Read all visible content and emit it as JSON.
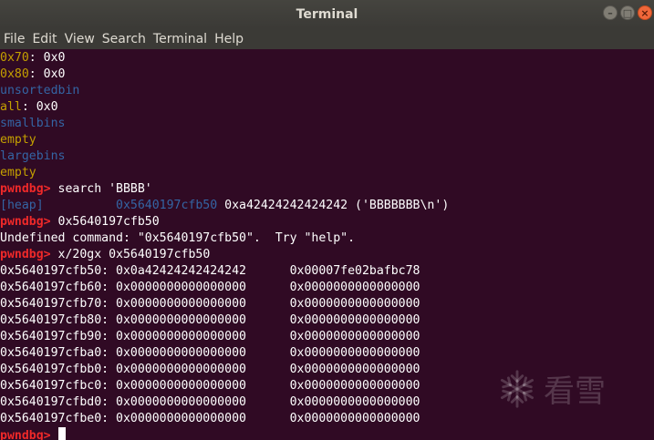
{
  "window": {
    "title": "Terminal"
  },
  "menu": [
    "File",
    "Edit",
    "View",
    "Search",
    "Terminal",
    "Help"
  ],
  "terminal": {
    "lines": [
      [
        {
          "t": "0x70",
          "c": "yellow"
        },
        {
          "t": ": 0x0",
          "c": ""
        }
      ],
      [
        {
          "t": "0x80",
          "c": "yellow"
        },
        {
          "t": ": 0x0",
          "c": ""
        }
      ],
      [
        {
          "t": "unsortedbin",
          "c": "blue"
        }
      ],
      [
        {
          "t": "all",
          "c": "yellow"
        },
        {
          "t": ": 0x0",
          "c": ""
        }
      ],
      [
        {
          "t": "smallbins",
          "c": "blue"
        }
      ],
      [
        {
          "t": "empty",
          "c": "yellow"
        }
      ],
      [
        {
          "t": "largebins",
          "c": "blue"
        }
      ],
      [
        {
          "t": "empty",
          "c": "yellow"
        }
      ],
      [
        {
          "t": "pwndbg> ",
          "c": "red"
        },
        {
          "t": "search 'BBBB'",
          "c": ""
        }
      ],
      [
        {
          "t": "[heap]          0x5640197cfb50",
          "c": "blue"
        },
        {
          "t": " 0xa42424242424242 ('BBBBBBB\\n')",
          "c": ""
        }
      ],
      [
        {
          "t": "pwndbg> ",
          "c": "red"
        },
        {
          "t": "0x5640197cfb50",
          "c": ""
        }
      ],
      [
        {
          "t": "Undefined command: \"0x5640197cfb50\".  Try \"help\".",
          "c": ""
        }
      ],
      [
        {
          "t": "pwndbg> ",
          "c": "red"
        },
        {
          "t": "x/20gx 0x5640197cfb50",
          "c": ""
        }
      ],
      [
        {
          "t": "0x5640197cfb50: 0x0a42424242424242      0x00007fe02bafbc78",
          "c": ""
        }
      ],
      [
        {
          "t": "0x5640197cfb60: 0x0000000000000000      0x0000000000000000",
          "c": ""
        }
      ],
      [
        {
          "t": "0x5640197cfb70: 0x0000000000000000      0x0000000000000000",
          "c": ""
        }
      ],
      [
        {
          "t": "0x5640197cfb80: 0x0000000000000000      0x0000000000000000",
          "c": ""
        }
      ],
      [
        {
          "t": "0x5640197cfb90: 0x0000000000000000      0x0000000000000000",
          "c": ""
        }
      ],
      [
        {
          "t": "0x5640197cfba0: 0x0000000000000000      0x0000000000000000",
          "c": ""
        }
      ],
      [
        {
          "t": "0x5640197cfbb0: 0x0000000000000000      0x0000000000000000",
          "c": ""
        }
      ],
      [
        {
          "t": "0x5640197cfbc0: 0x0000000000000000      0x0000000000000000",
          "c": ""
        }
      ],
      [
        {
          "t": "0x5640197cfbd0: 0x0000000000000000      0x0000000000000000",
          "c": ""
        }
      ],
      [
        {
          "t": "0x5640197cfbe0: 0x0000000000000000      0x0000000000000000",
          "c": ""
        }
      ],
      [
        {
          "t": "pwndbg> ",
          "c": "red"
        }
      ]
    ]
  },
  "watermark": {
    "text": "看雪"
  },
  "colors": {
    "background": "#300a24",
    "prompt": "#ef2929",
    "yellow": "#c4a000",
    "blue": "#3465a4"
  }
}
